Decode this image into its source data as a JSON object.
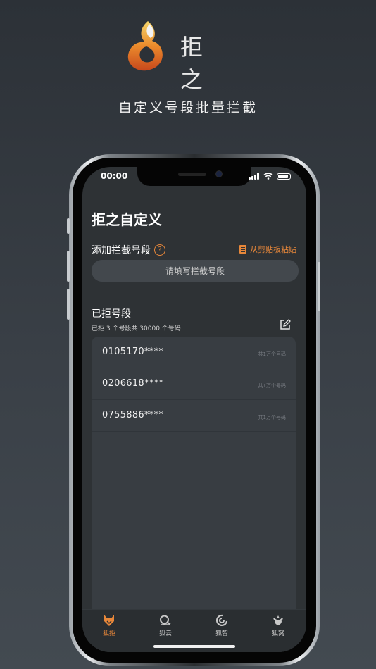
{
  "promo": {
    "brand": "拒 之",
    "headline": "自定义号段批量拦截"
  },
  "status_bar": {
    "time": "00:00"
  },
  "page": {
    "title": "拒之自定义",
    "add_section_label": "添加拦截号段",
    "paste_label": "从剪贴板粘贴",
    "input_placeholder": "请填写拦截号段",
    "blocked_title": "已拒号段",
    "blocked_summary": "已拒 3 个号段共 30000 个号码"
  },
  "blocked_segments": [
    {
      "number": "0105170****",
      "count": "共1万个号码"
    },
    {
      "number": "0206618****",
      "count": "共1万个号码"
    },
    {
      "number": "0755886****",
      "count": "共1万个号码"
    }
  ],
  "tabs": [
    {
      "label": "狐拒",
      "icon": "fox-head-icon",
      "active": true
    },
    {
      "label": "狐云",
      "icon": "cloud-search-icon",
      "active": false
    },
    {
      "label": "狐智",
      "icon": "swirl-icon",
      "active": false
    },
    {
      "label": "狐窝",
      "icon": "nest-icon",
      "active": false
    }
  ],
  "colors": {
    "accent": "#e7873a",
    "background": "#2e3235",
    "panel": "#383d42"
  }
}
